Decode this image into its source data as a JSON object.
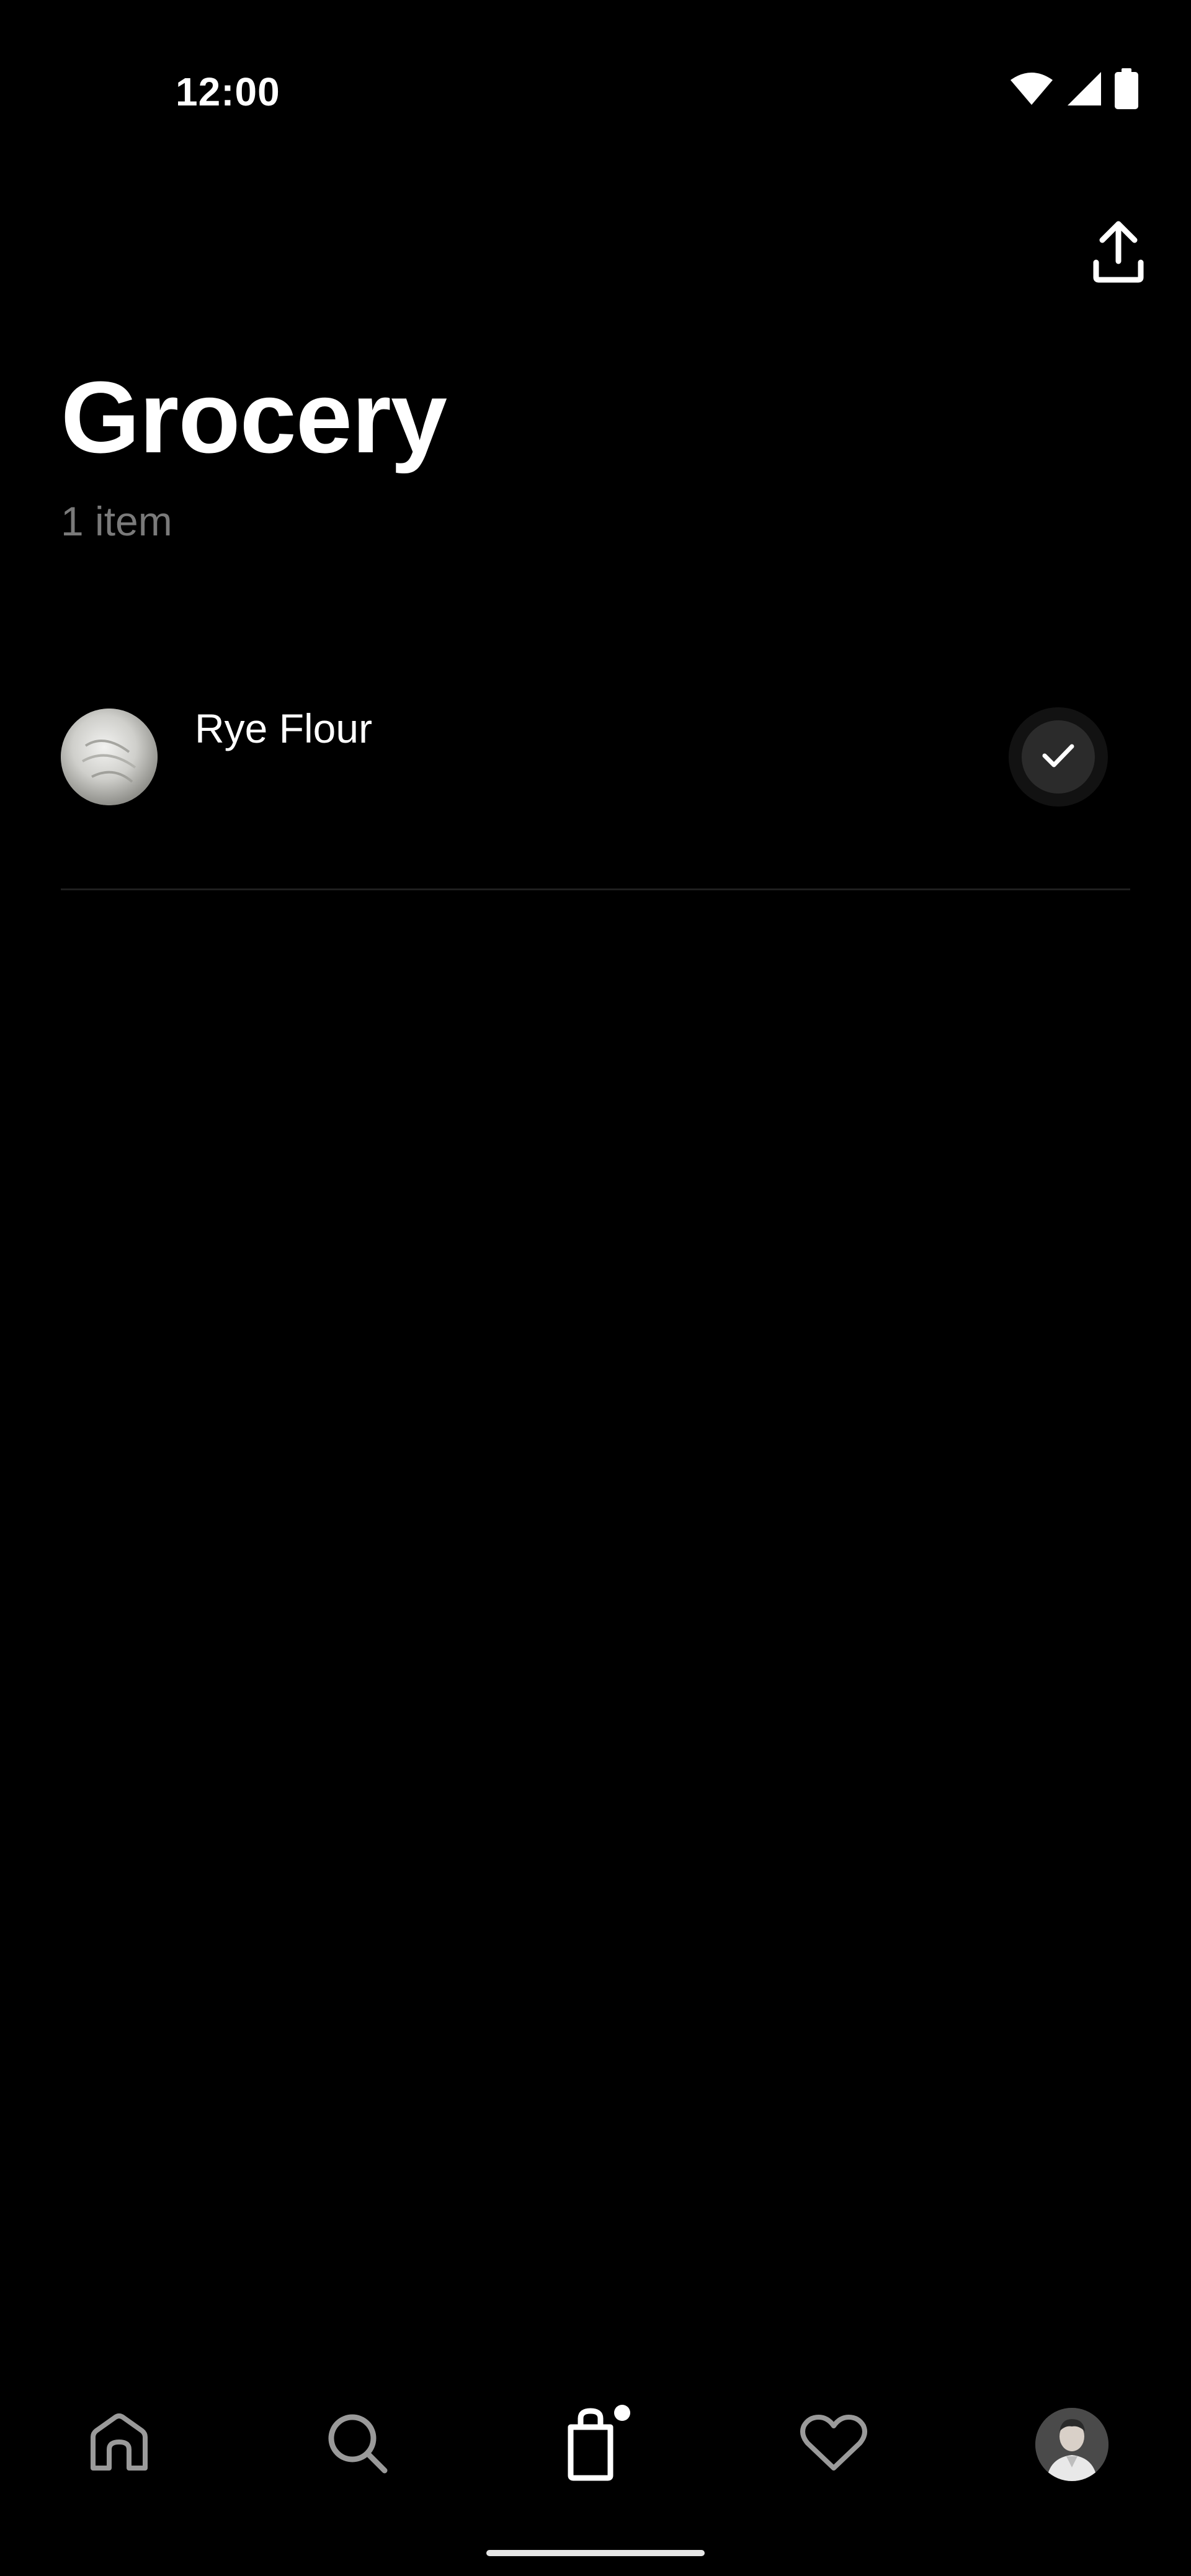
{
  "status_bar": {
    "time": "12:00",
    "icons": [
      "wifi-icon",
      "cellular-signal-icon",
      "battery-icon"
    ]
  },
  "header": {
    "share_icon": "share-upload-icon",
    "title": "Grocery",
    "item_count": "1 item"
  },
  "list": {
    "items": [
      {
        "name": "Rye Flour",
        "thumbnail": "rye-flour-image",
        "checked": true
      }
    ]
  },
  "bottom_nav": {
    "items": [
      {
        "icon": "home-icon",
        "active": false
      },
      {
        "icon": "search-icon",
        "active": false
      },
      {
        "icon": "shopping-bag-icon",
        "active": true,
        "has_badge": true
      },
      {
        "icon": "heart-icon",
        "active": false
      },
      {
        "icon": "avatar",
        "active": false
      }
    ]
  },
  "colors": {
    "background": "#000000",
    "text_primary": "#ffffff",
    "text_secondary": "#7a7a7a",
    "nav_inactive": "#9a9a9a",
    "divider": "#1f1f1f"
  }
}
